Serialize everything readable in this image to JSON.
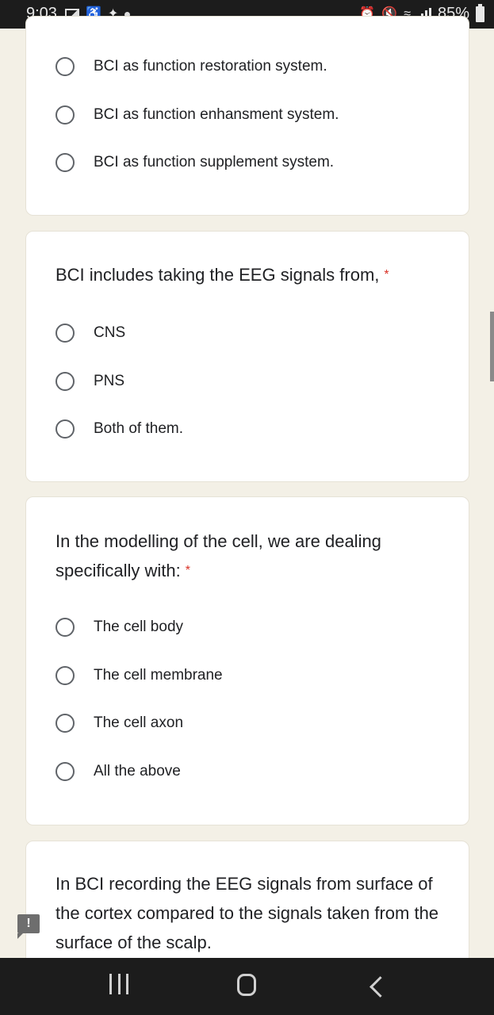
{
  "status_bar": {
    "time": "9:03",
    "left_icons": [
      "gallery-icon",
      "accessibility-icon",
      "twitter-icon",
      "dot-icon"
    ],
    "right_icons": [
      "alarm-icon",
      "mute-icon",
      "wifi-icon",
      "signal-icon"
    ],
    "battery": "85%"
  },
  "questions": [
    {
      "title": "",
      "required": false,
      "options": [
        "BCI as function restoration system.",
        "BCI as function enhansment system.",
        "BCI as function supplement system."
      ]
    },
    {
      "title": "BCI includes taking the EEG signals from,",
      "required": true,
      "required_mark": "*",
      "options": [
        "CNS",
        "PNS",
        "Both of them."
      ]
    },
    {
      "title": "In the modelling of the cell, we are dealing specifically with:",
      "required": true,
      "required_mark": "*",
      "options": [
        "The cell body",
        "The cell membrane",
        "The cell axon",
        "All the above"
      ]
    },
    {
      "title": "In BCI recording the EEG signals from surface of the cortex compared to the signals taken from the surface of the scalp.",
      "required": false,
      "options": []
    }
  ],
  "feedback_icon": "!",
  "nav_bar": {
    "recents": "recents-icon",
    "home": "home-icon",
    "back": "back-icon"
  }
}
